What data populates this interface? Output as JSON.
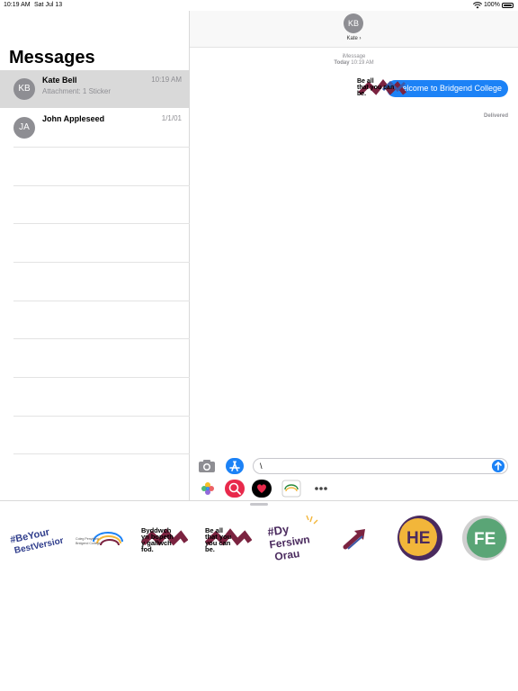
{
  "status_bar": {
    "time": "10:19 AM",
    "date": "Sat Jul 13",
    "battery": "100%"
  },
  "sidebar": {
    "title": "Messages",
    "conversations": [
      {
        "initials": "KB",
        "name": "Kate Bell",
        "preview": "Attachment: 1 Sticker",
        "time": "10:19 AM",
        "selected": true
      },
      {
        "initials": "JA",
        "name": "John Appleseed",
        "preview": "",
        "time": "1/1/01",
        "selected": false
      }
    ]
  },
  "chat": {
    "contact_initials": "KB",
    "contact_name": "Kate ›",
    "service": "iMessage",
    "timestamp_day": "Today",
    "timestamp_time": "10:19 AM",
    "message": "Welcome to Bridgend College",
    "status": "Delivered",
    "sticker_text": "Be all that you can be."
  },
  "compose": {
    "value": "\\"
  },
  "sticker_tray": {
    "items": [
      {
        "name": "sticker-be-your-best-version",
        "text": "#BeYour BestVersion"
      },
      {
        "name": "sticker-coleg-logo",
        "text": "Coleg Penybont Bridgend College"
      },
      {
        "name": "sticker-byddwch",
        "text": "Byddwch yn bopeth y gallwch fod."
      },
      {
        "name": "sticker-be-all",
        "text": "Be all that you can be."
      },
      {
        "name": "sticker-dy-fersiwn-orau",
        "text": "#Dy Fersiwn Orau"
      },
      {
        "name": "sticker-arrow",
        "text": ""
      },
      {
        "name": "sticker-he",
        "text": "HE"
      },
      {
        "name": "sticker-fe",
        "text": "FE"
      }
    ]
  },
  "colors": {
    "accent": "#1c82f6",
    "maroon": "#7b2340",
    "fe_green": "#5aa576",
    "he_yellow": "#f2b63a",
    "purple": "#4a2a5e"
  }
}
